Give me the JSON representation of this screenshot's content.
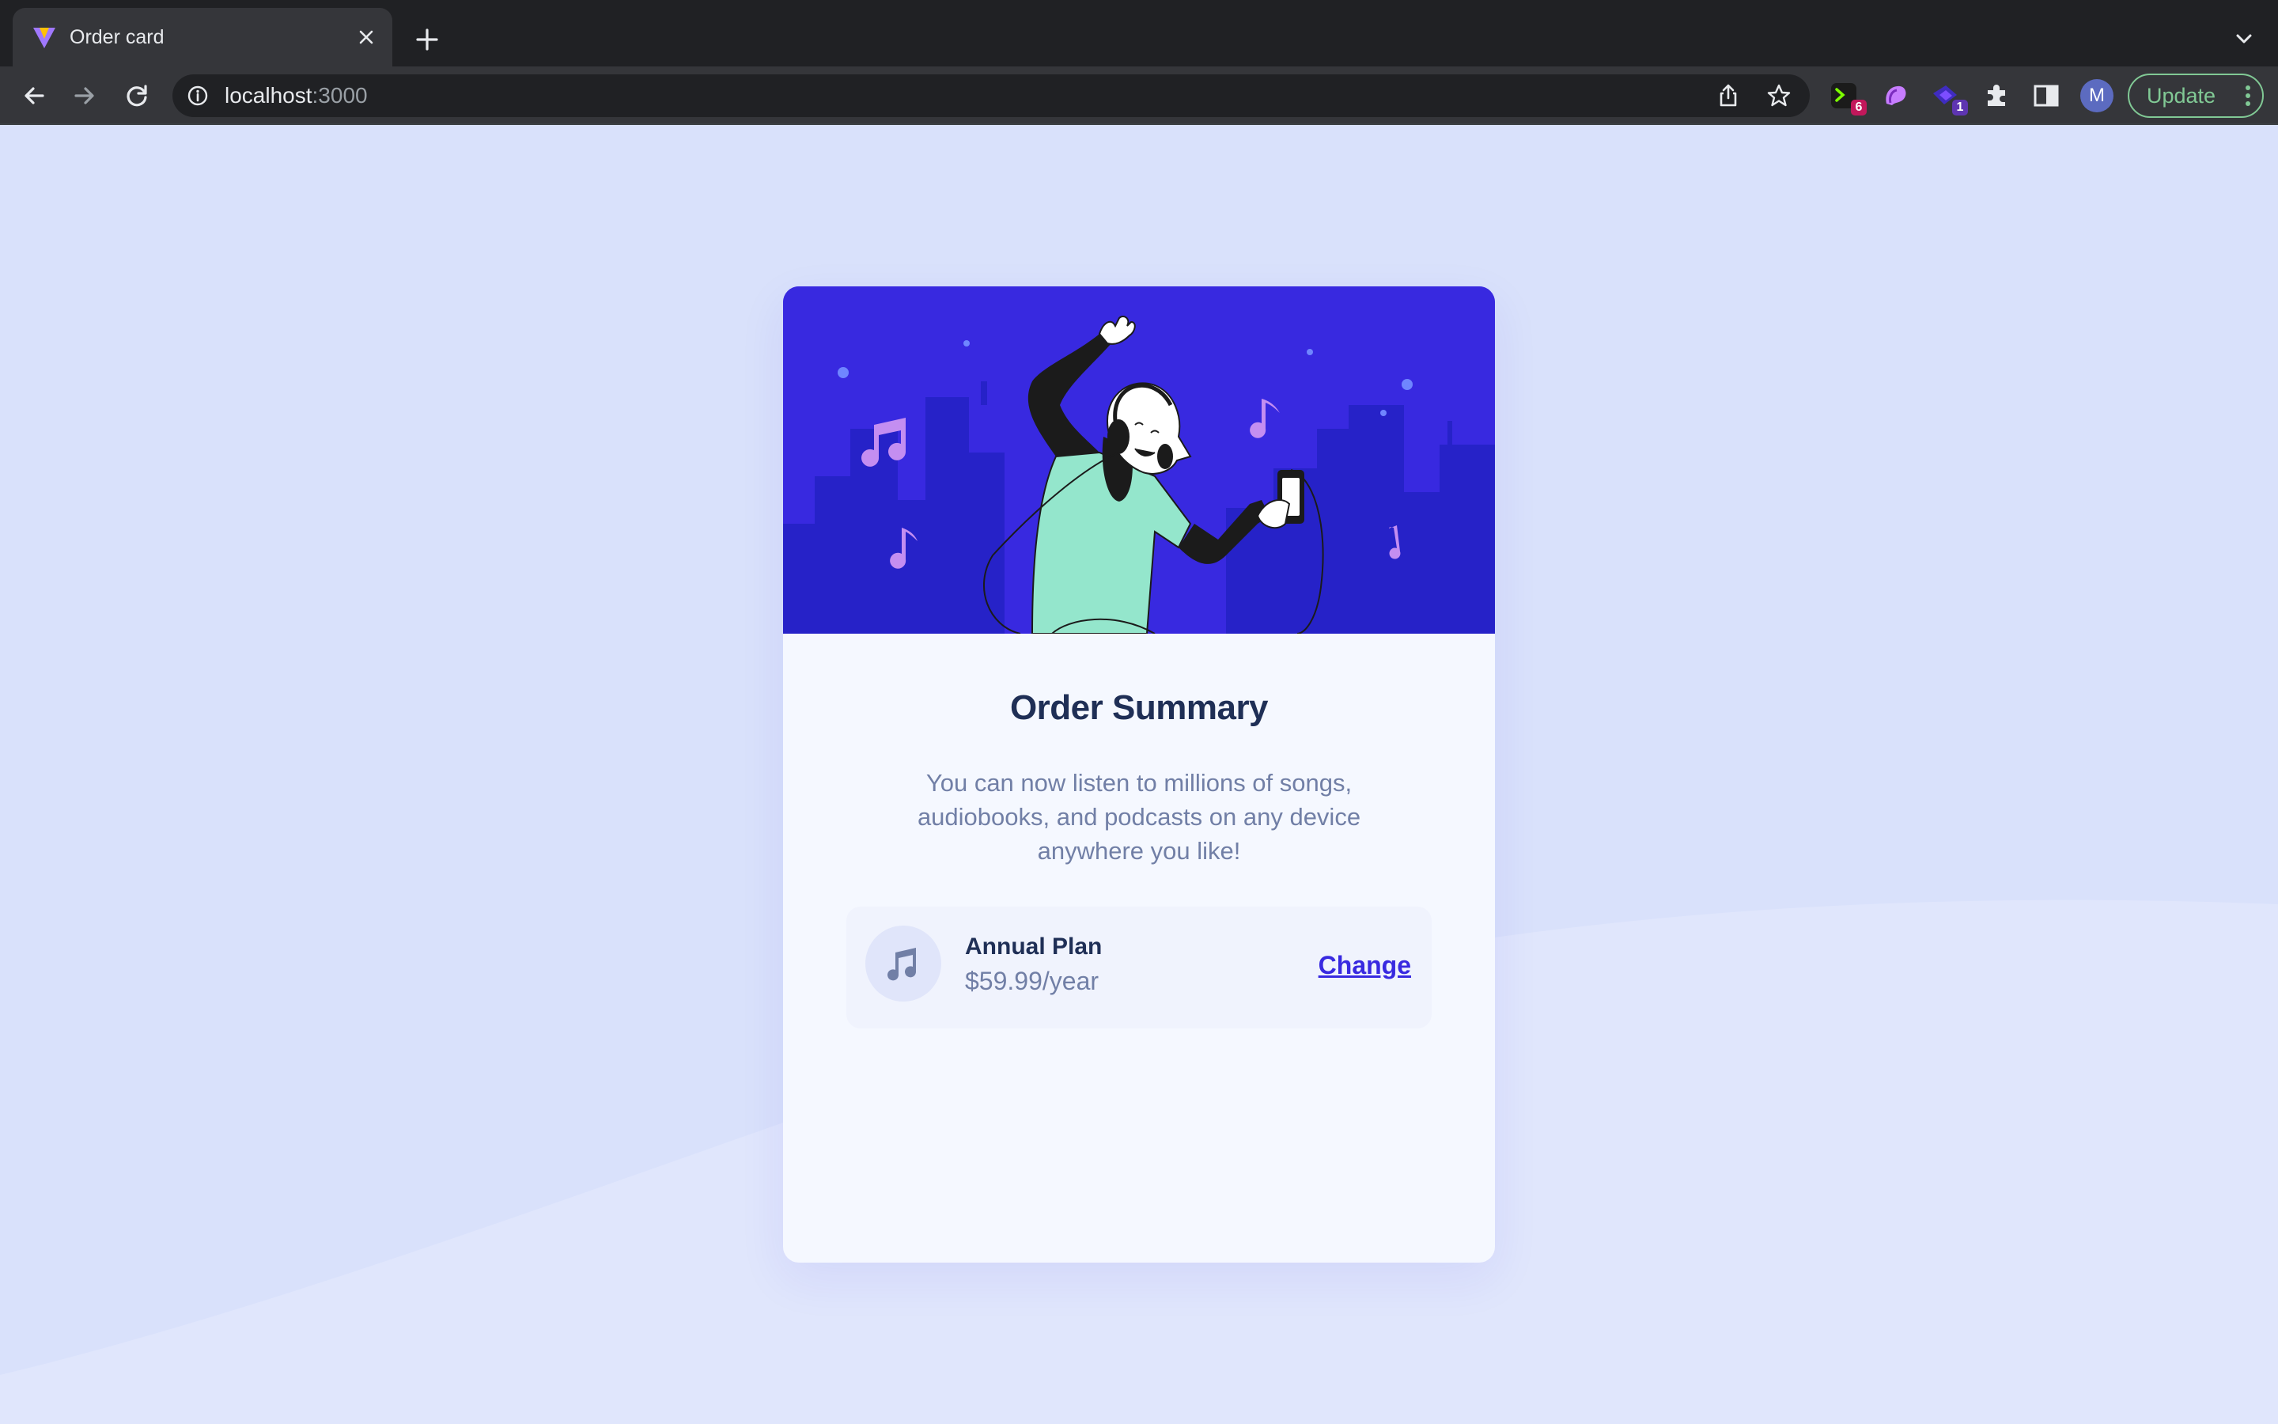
{
  "browser": {
    "tab_title": "Order card",
    "url_host": "localhost",
    "url_port": ":3000",
    "avatar_letter": "M",
    "update_label": "Update",
    "extensions": [
      {
        "name": "terminal-extension",
        "badge": "6",
        "badge_color": "#c2185b"
      },
      {
        "name": "paint-extension",
        "badge": ""
      },
      {
        "name": "purple-extension",
        "badge": "1",
        "badge_color": "#5e35b1"
      }
    ]
  },
  "card": {
    "title": "Order Summary",
    "description": "You can now listen to millions of songs, audiobooks, and podcasts on any device anywhere you like!",
    "plan": {
      "name": "Annual Plan",
      "price": "$59.99/year",
      "change_label": "Change"
    }
  },
  "colors": {
    "page_bg": "#d9e1fb",
    "hero_bg": "#3829e0",
    "title": "#1f2f56",
    "muted": "#717fa6",
    "accent": "#3829e0"
  }
}
